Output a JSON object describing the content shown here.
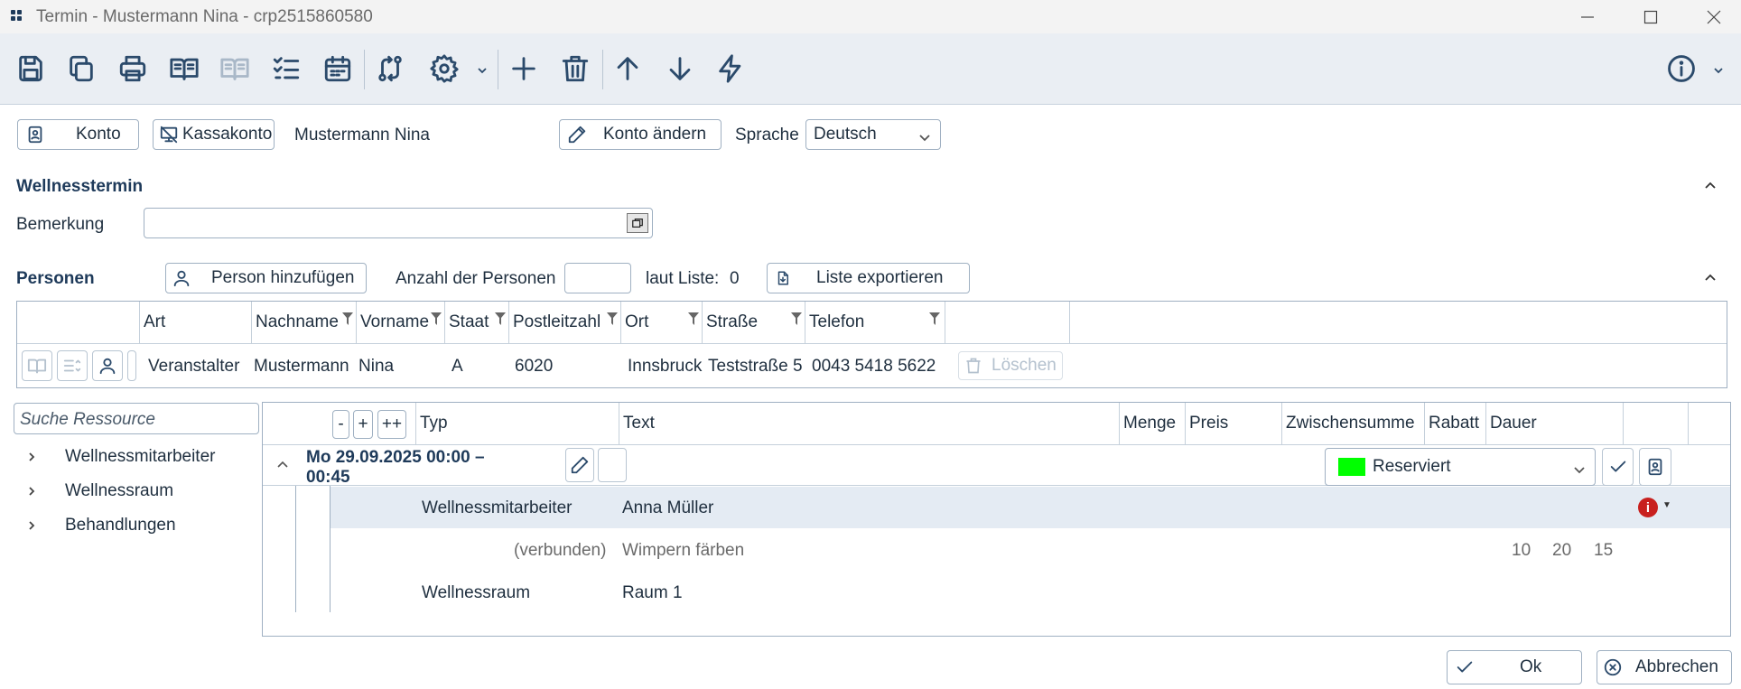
{
  "window": {
    "title": "Termin - Mustermann Nina - crp2515860580"
  },
  "toolbar": {
    "icons": [
      "save-icon",
      "copy-icon",
      "print-icon",
      "book-open-icon",
      "book-open-disabled-icon",
      "checklist-icon",
      "calendar-icon",
      "route-icon",
      "gear-icon",
      "plus-icon",
      "trash-icon",
      "arrow-up-icon",
      "arrow-down-icon",
      "lightning-icon",
      "info-icon"
    ]
  },
  "account": {
    "konto_label": "Konto",
    "kassakonto_label": "Kassakonto",
    "name": "Mustermann Nina",
    "konto_aendern_label": "Konto ändern",
    "sprache_label": "Sprache",
    "sprache_value": "Deutsch"
  },
  "wellness": {
    "title": "Wellnesstermin",
    "bemerkung_label": "Bemerkung",
    "bemerkung_value": ""
  },
  "personen": {
    "title": "Personen",
    "add_label": "Person hinzufügen",
    "anzahl_label": "Anzahl der Personen",
    "anzahl_value": "",
    "laut_liste_label": "laut Liste:",
    "laut_liste_value": "0",
    "export_label": "Liste exportieren",
    "columns": [
      "Art",
      "Nachname",
      "Vorname",
      "Staat",
      "Postleitzahl",
      "Ort",
      "Straße",
      "Telefon"
    ],
    "rows": [
      {
        "art": "Veranstalter",
        "nachname": "Mustermann",
        "vorname": "Nina",
        "staat": "A",
        "plz": "6020",
        "ort": "Innsbruck",
        "strasse": "Teststraße 5",
        "telefon": "0043 5418 5622",
        "loeschen": "Löschen"
      }
    ]
  },
  "ressource": {
    "search_placeholder": "Suche Ressource",
    "tree": [
      "Wellnessmitarbeiter",
      "Wellnessraum",
      "Behandlungen"
    ]
  },
  "termin_grid": {
    "btn_minus": "-",
    "btn_plus": "+",
    "btn_plusplus": "++",
    "columns": [
      "Typ",
      "Text",
      "Menge",
      "Preis",
      "Zwischensumme",
      "Rabatt",
      "Dauer"
    ],
    "group_date_line1": "Mo 29.09.2025 00:00 –",
    "group_date_line2": "00:45",
    "status": "Reserviert",
    "status_color": "#00ff00",
    "rows": [
      {
        "typ": "Wellnessmitarbeiter",
        "text": "Anna Müller"
      },
      {
        "typ": "(verbunden)",
        "text": "Wimpern färben",
        "v1": "10",
        "v2": "20",
        "v3": "15"
      },
      {
        "typ": "Wellnessraum",
        "text": "Raum 1"
      }
    ]
  },
  "footer": {
    "ok_label": "Ok",
    "cancel_label": "Abbrechen"
  }
}
